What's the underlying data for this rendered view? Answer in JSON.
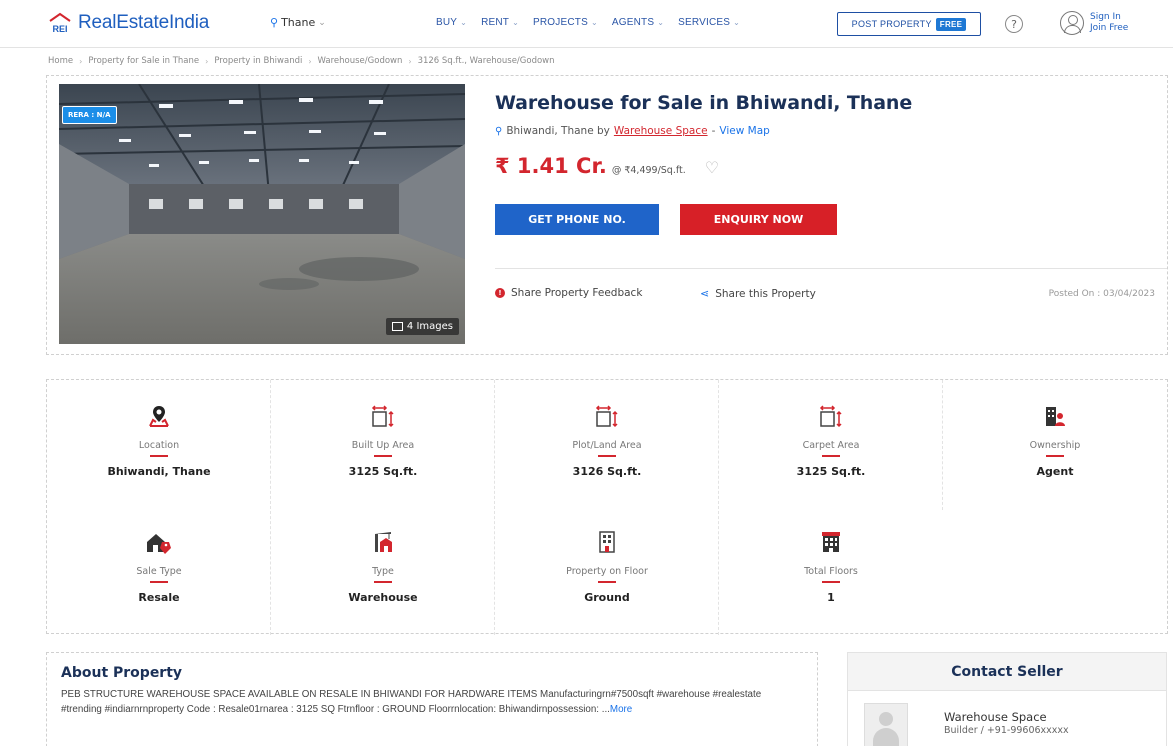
{
  "header": {
    "logo_mark": "REI",
    "logo_text": "RealEstateIndia",
    "city": "Thane",
    "nav": [
      {
        "label": "BUY"
      },
      {
        "label": "RENT"
      },
      {
        "label": "PROJECTS"
      },
      {
        "label": "AGENTS"
      },
      {
        "label": "SERVICES"
      }
    ],
    "post_property": "POST PROPERTY",
    "free_badge": "FREE",
    "help": "?",
    "sign_in": "Sign In",
    "join_free": "Join Free"
  },
  "breadcrumb": [
    "Home",
    "Property for Sale in Thane",
    "Property in Bhiwandi",
    "Warehouse/Godown",
    "3126 Sq.ft., Warehouse/Godown"
  ],
  "listing": {
    "rera": "RERA : N/A",
    "image_count": "4 Images",
    "title": "Warehouse for Sale in Bhiwandi, Thane",
    "location_prefix": "Bhiwandi, Thane by",
    "agent": "Warehouse Space",
    "separator": "-",
    "view_map": "View Map",
    "price": "₹ 1.41 Cr.",
    "rate": "@ ₹4,499/Sq.ft.",
    "btn_phone": "GET PHONE NO.",
    "btn_enquiry": "ENQUIRY NOW",
    "feedback": "Share Property Feedback",
    "share": "Share this Property",
    "posted": "Posted On : 03/04/2023"
  },
  "details": [
    {
      "label": "Location",
      "value": "Bhiwandi, Thane",
      "icon": "location-icon"
    },
    {
      "label": "Built Up Area",
      "value": "3125 Sq.ft.",
      "icon": "area-icon"
    },
    {
      "label": "Plot/Land Area",
      "value": "3126 Sq.ft.",
      "icon": "area-icon"
    },
    {
      "label": "Carpet Area",
      "value": "3125 Sq.ft.",
      "icon": "area-icon"
    },
    {
      "label": "Ownership",
      "value": "Agent",
      "icon": "ownership-icon"
    },
    {
      "label": "Sale Type",
      "value": "Resale",
      "icon": "sale-type-icon"
    },
    {
      "label": "Type",
      "value": "Warehouse",
      "icon": "warehouse-icon"
    },
    {
      "label": "Property on Floor",
      "value": "Ground",
      "icon": "floor-icon"
    },
    {
      "label": "Total Floors",
      "value": "1",
      "icon": "building-icon"
    }
  ],
  "about": {
    "title": "About Property",
    "text": "PEB STRUCTURE WAREHOUSE SPACE AVAILABLE ON RESALE IN BHIWANDI FOR HARDWARE ITEMS Manufacturingrn#7500sqft #warehouse #realestate #trending #indiarnrnproperty Code : Resale01rnarea : 3125 SQ Ftrnfloor : GROUND Floorrnlocation: Bhiwandirnpossession: ...",
    "more": "More"
  },
  "contact": {
    "title": "Contact Seller",
    "name": "Warehouse Space",
    "sub": "Builder  / +91-99606xxxxx"
  },
  "colors": {
    "brand_blue": "#1f5fbf",
    "title_navy": "#1b3158",
    "price_red": "#d3262e",
    "phone_btn": "#1f64c9",
    "enquiry_btn": "#d72027"
  }
}
